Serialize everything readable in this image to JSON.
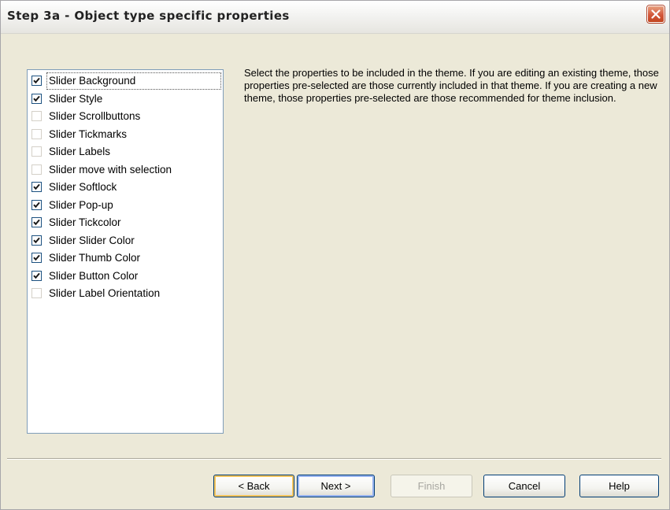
{
  "window": {
    "title": "Step 3a - Object type specific properties"
  },
  "instructions": "Select the properties to be included in the theme. If you are editing an existing theme, those properties pre-selected are those currently included in that theme. If you are creating a new theme, those properties pre-selected are those recommended for theme inclusion.",
  "properties": [
    {
      "label": "Slider Background",
      "checked": true
    },
    {
      "label": "Slider Style",
      "checked": true
    },
    {
      "label": "Slider Scrollbuttons",
      "checked": false
    },
    {
      "label": "Slider Tickmarks",
      "checked": false
    },
    {
      "label": "Slider Labels",
      "checked": false
    },
    {
      "label": "Slider move with selection",
      "checked": false
    },
    {
      "label": "Slider Softlock",
      "checked": true
    },
    {
      "label": "Slider Pop-up",
      "checked": true
    },
    {
      "label": "Slider Tickcolor",
      "checked": true
    },
    {
      "label": "Slider Slider Color",
      "checked": true
    },
    {
      "label": "Slider Thumb Color",
      "checked": true
    },
    {
      "label": "Slider Button Color",
      "checked": true
    },
    {
      "label": "Slider Label Orientation",
      "checked": false
    }
  ],
  "buttons": {
    "back": "< Back",
    "next": "Next >",
    "finish": "Finish",
    "cancel": "Cancel",
    "help": "Help"
  },
  "icons": {
    "close": "close-icon",
    "check": "checkmark-icon"
  },
  "colors": {
    "dialog_background": "#ece9d8",
    "close_button": "#d2573a",
    "list_border": "#7f9db9",
    "default_button_highlight": "#f4c55c",
    "focus_button_highlight": "#98b4f0"
  }
}
